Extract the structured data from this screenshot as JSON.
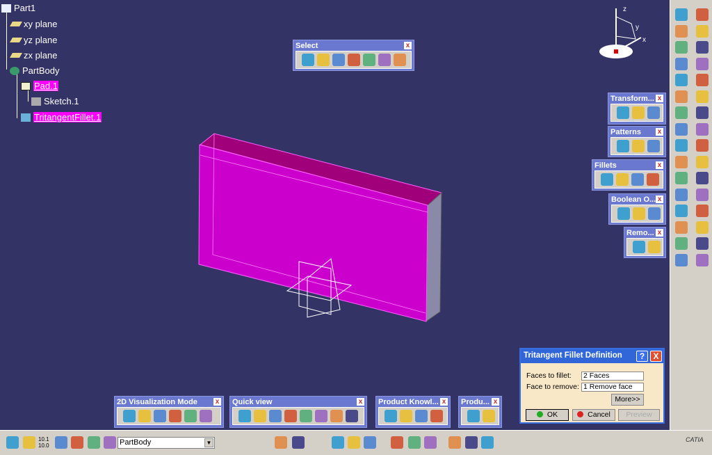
{
  "tree": {
    "root": "Part1",
    "items": [
      "xy plane",
      "yz plane",
      "zx plane",
      "PartBody",
      "Pad.1",
      "Sketch.1",
      "TritangentFillet.1"
    ]
  },
  "toolbars": {
    "select": {
      "title": "Select",
      "icons": [
        "select-arrow-icon",
        "select-box-icon",
        "intersecting-box-icon",
        "polygon-select-icon",
        "free-hand-select-icon",
        "outside-box-icon",
        "outside-intersect-icon"
      ]
    },
    "transform": {
      "title": "Transform...",
      "icons": [
        "translation-icon",
        "rotation-icon",
        "symmetry-icon"
      ]
    },
    "patterns": {
      "title": "Patterns",
      "icons": [
        "rectangular-pattern-icon",
        "circular-pattern-icon",
        "user-pattern-icon"
      ]
    },
    "fillets": {
      "title": "Fillets",
      "icons": [
        "edge-fillet-icon",
        "face-face-fillet-icon",
        "tritangent-fillet-icon",
        "chamfer-icon"
      ]
    },
    "boolean": {
      "title": "Boolean O...",
      "icons": [
        "assemble-icon",
        "intersect-icon",
        "union-trim-icon"
      ]
    },
    "remove": {
      "title": "Remo...",
      "icons": [
        "remove-lump-icon",
        "sew-surface-icon"
      ]
    },
    "viz2d": {
      "title": "2D Visualization Mode",
      "icons": [
        "pickable-icon",
        "no-3d-icon",
        "hide-icon",
        "low-light-icon",
        "low-light-hide-icon",
        "visualization-options-icon"
      ]
    },
    "quickview": {
      "title": "Quick view",
      "icons": [
        "iso-view-icon",
        "front-view-icon",
        "back-view-icon",
        "left-view-icon",
        "right-view-icon",
        "top-view-icon",
        "bottom-view-icon",
        "named-views-icon"
      ]
    },
    "knowledge": {
      "title": "Product Knowl...",
      "icons": [
        "knowledge-check-icon",
        "product-rule-icon",
        "save-rule-icon",
        "report-icon"
      ]
    },
    "produ": {
      "title": "Produ...",
      "icons": [
        "product-icon-1",
        "product-icon-2"
      ]
    }
  },
  "bottom": {
    "current_body": "PartBody",
    "scale_label": "10.1 10.0"
  },
  "dialog": {
    "title": "Tritangent Fillet Definition",
    "help": "?",
    "close": "X",
    "faces_label": "Faces to fillet:",
    "faces_value": "2 Faces",
    "remove_label": "Face to remove:",
    "remove_value": "1 Remove face",
    "more": "More>>",
    "ok": "OK",
    "cancel": "Cancel",
    "preview": "Preview"
  },
  "compass": {
    "x": "x",
    "y": "y",
    "z": "z"
  },
  "logo": "CATIA",
  "colors": {
    "background": "#333366",
    "selection": "#ff00ff",
    "part": "#cc00cc"
  }
}
